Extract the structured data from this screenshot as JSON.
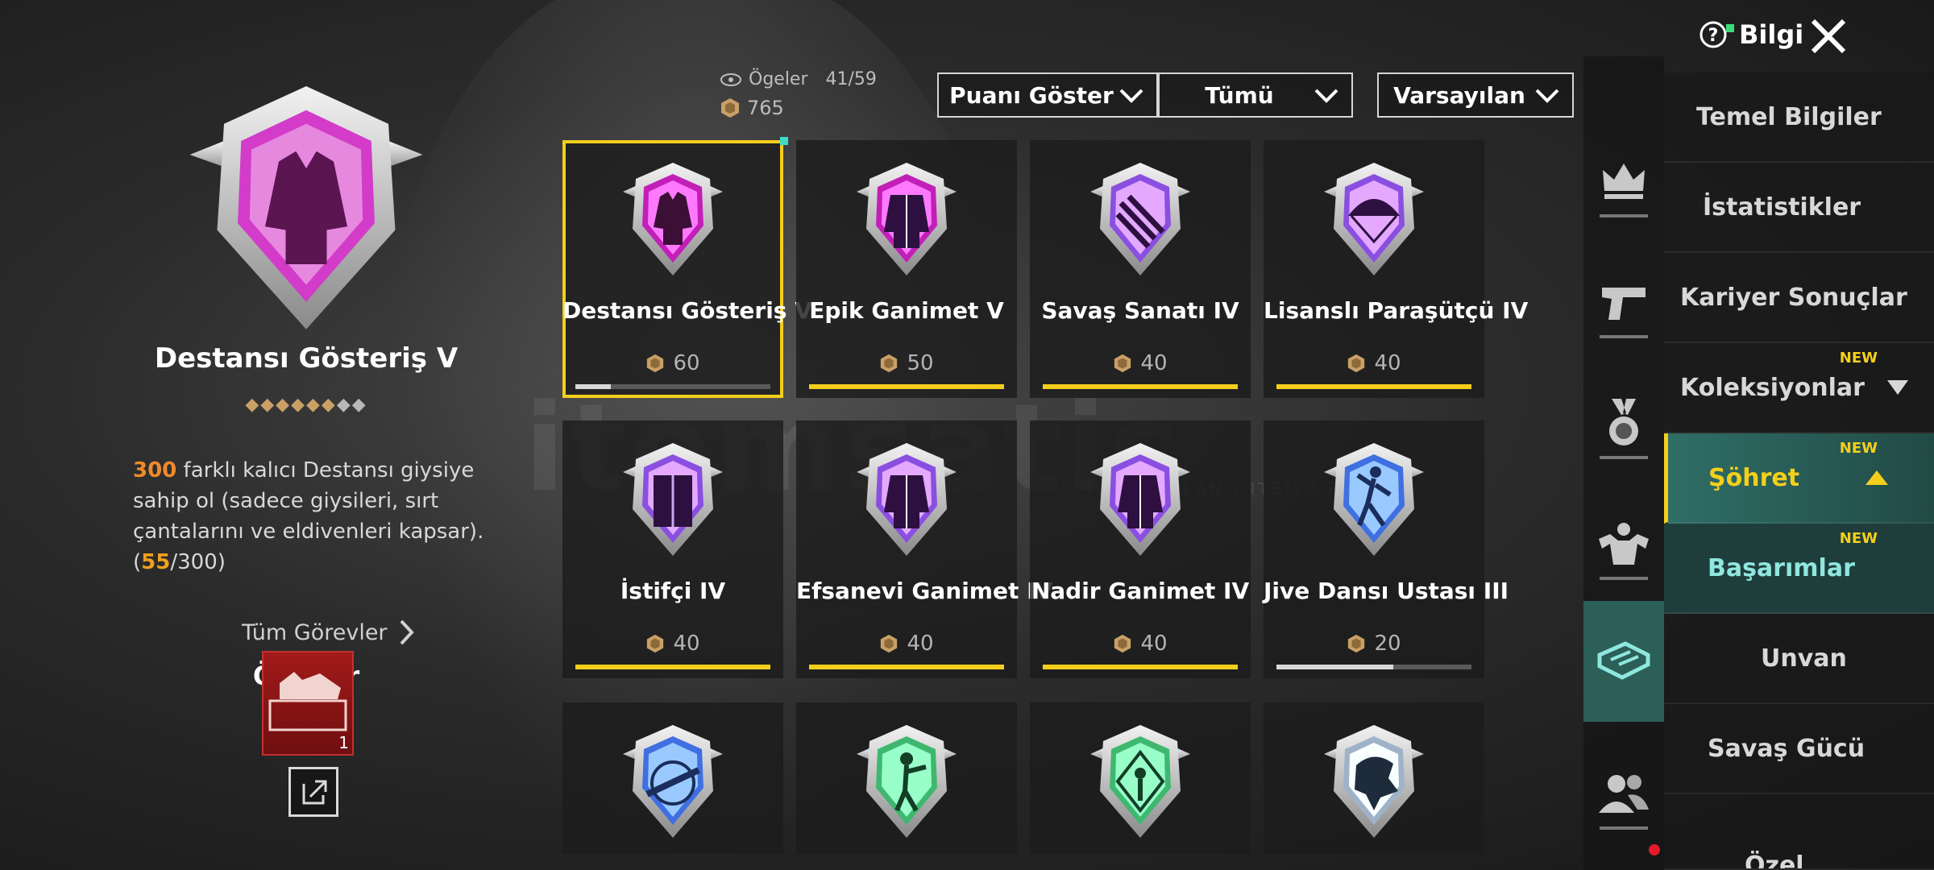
{
  "watermark": {
    "text": "itemsatis",
    "sub": "HESAP / İLAN / ITEM / E-PIN"
  },
  "header": {
    "items_label": "Ögeler",
    "items_value": "41/59",
    "points_value": "765",
    "dropdowns": [
      "Puanı Göster",
      "Tümü",
      "Varsayılan"
    ],
    "info_label": "Bilgi"
  },
  "detail": {
    "title": "Destansı Gösteriş V",
    "stars_filled": 6,
    "stars_total": 8,
    "desc_count": "300",
    "desc_text": " farklı kalıcı Destansı giysiye sahip ol (sadece giysileri, sırt çantalarını ve eldivenleri kapsar). (",
    "desc_progress": "55",
    "desc_total": "/300)",
    "all_tasks_label": "Tüm Görevler",
    "rewards_title": "Ödüller",
    "reward_count": "1"
  },
  "achievements": [
    {
      "name": "Destansı Gösteriş V",
      "points": "60",
      "progress": 0.18,
      "color": "#c21fb8",
      "icon": "jacket-icon",
      "selected": true
    },
    {
      "name": "Epik Ganimet V",
      "points": "50",
      "progress": 1.0,
      "color": "#c21fb8",
      "icon": "robe-icon"
    },
    {
      "name": "Savaş Sanatı IV",
      "points": "40",
      "progress": 1.0,
      "color": "#8a4fe0",
      "icon": "claw-icon"
    },
    {
      "name": "Lisanslı Paraşütçü IV",
      "points": "40",
      "progress": 1.0,
      "color": "#8a4fe0",
      "icon": "parachute-icon"
    },
    {
      "name": "İstifçi IV",
      "points": "40",
      "progress": 1.0,
      "color": "#8a4fe0",
      "icon": "locker-icon"
    },
    {
      "name": "Efsanevi Ganimet IV",
      "points": "40",
      "progress": 1.0,
      "color": "#8a4fe0",
      "icon": "robe-icon"
    },
    {
      "name": "Nadir Ganimet IV",
      "points": "40",
      "progress": 1.0,
      "color": "#8a4fe0",
      "icon": "robe-icon"
    },
    {
      "name": "Jive Dansı Ustası III",
      "points": "20",
      "progress": 0.6,
      "color": "#3f6fe0",
      "icon": "dancer-icon"
    },
    {
      "name": "",
      "points": "",
      "progress": null,
      "color": "#3f6fe0",
      "icon": "crosshair-gun-icon"
    },
    {
      "name": "",
      "points": "",
      "progress": null,
      "color": "#3fb86f",
      "icon": "soldier-icon"
    },
    {
      "name": "",
      "points": "",
      "progress": null,
      "color": "#3fb86f",
      "icon": "diamond-soldier-icon"
    },
    {
      "name": "",
      "points": "",
      "progress": null,
      "color": "#9fb3c8",
      "icon": "eagle-icon"
    }
  ],
  "rail_icons": [
    "crown-icon",
    "pistol-icon",
    "medal-icon",
    "muscle-icon",
    "box-icon",
    "friends-icon"
  ],
  "menu": [
    {
      "label": "Temel Bilgiler"
    },
    {
      "label": "İstatistikler"
    },
    {
      "label": "Kariyer Sonuçlar"
    },
    {
      "label": "Koleksiyonlar",
      "new": "NEW",
      "caret": "down"
    },
    {
      "label": "Şöhret",
      "new": "NEW",
      "caret": "up",
      "active": true
    },
    {
      "label": "Başarımlar",
      "new": "NEW",
      "sub": true
    },
    {
      "label": "Unvan"
    },
    {
      "label": "Savaş Gücü"
    },
    {
      "label": "Özel"
    }
  ],
  "colors": {
    "accent": "#f3cf1c",
    "progress_full": "#f3cf1c",
    "progress_partial": "#d8d8d8",
    "highlight_orange": "#f08a2a"
  }
}
